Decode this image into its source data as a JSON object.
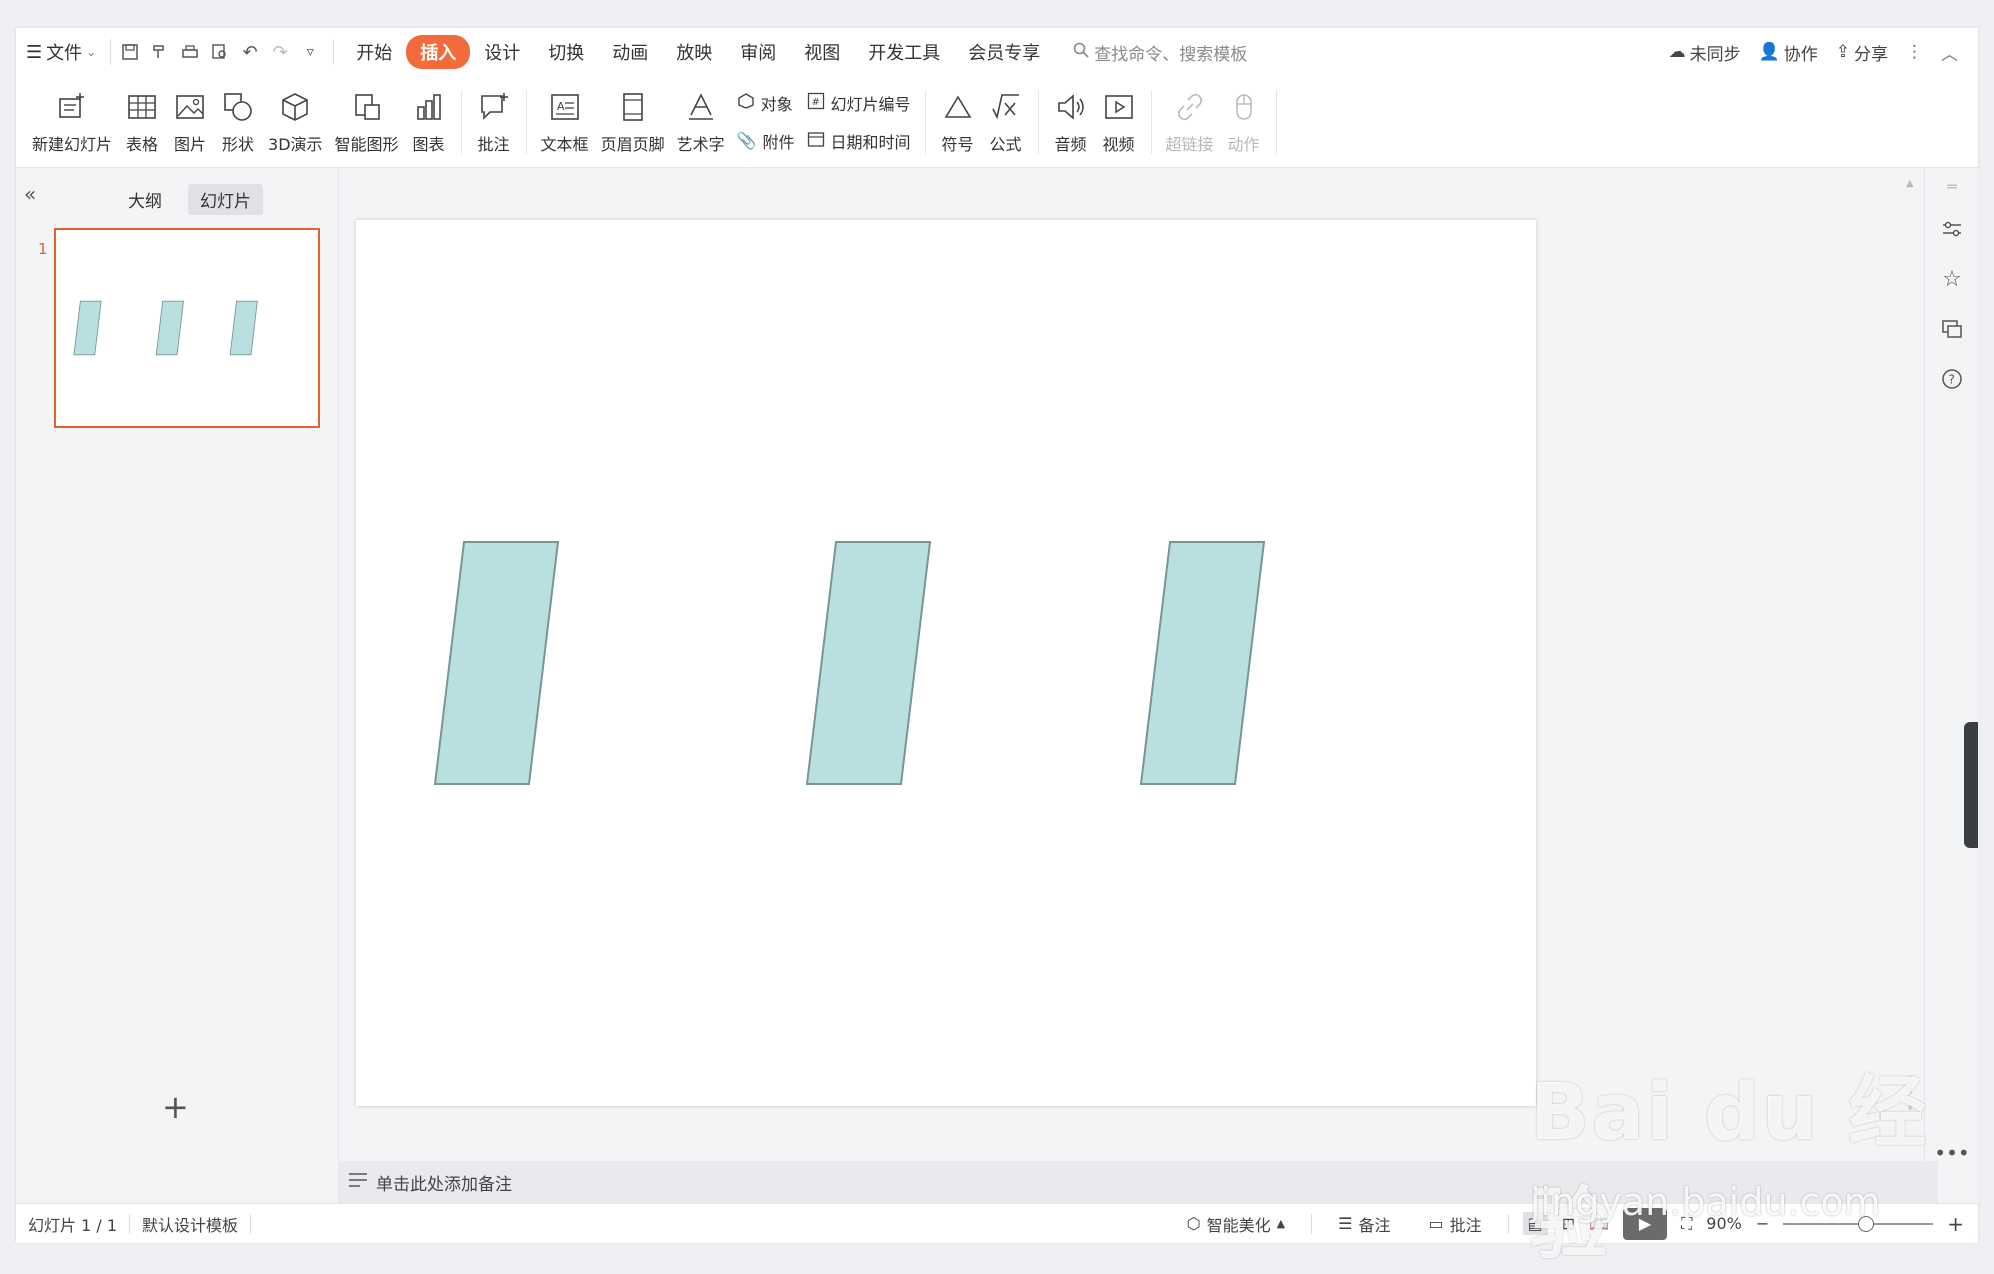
{
  "topbar": {
    "file_menu": "文件",
    "tabs": [
      "开始",
      "插入",
      "设计",
      "切换",
      "动画",
      "放映",
      "审阅",
      "视图",
      "开发工具",
      "会员专享"
    ],
    "active_tab": "插入",
    "search_placeholder": "查找命令、搜索模板",
    "sync": "未同步",
    "collab": "协作",
    "share": "分享"
  },
  "ribbon": {
    "new_slide": "新建幻灯片",
    "table": "表格",
    "picture": "图片",
    "shape": "形状",
    "demo3d": "3D演示",
    "smartart": "智能图形",
    "chart": "图表",
    "comment": "批注",
    "textbox": "文本框",
    "header_footer": "页眉页脚",
    "wordart": "艺术字",
    "object": "对象",
    "attachment": "附件",
    "slide_number": "幻灯片编号",
    "datetime": "日期和时间",
    "symbol": "符号",
    "formula": "公式",
    "audio": "音频",
    "video": "视频",
    "hyperlink": "超链接",
    "action": "动作"
  },
  "leftpanel": {
    "outline_tab": "大纲",
    "slides_tab": "幻灯片",
    "slide_number": "1"
  },
  "notes": {
    "placeholder": "单击此处添加备注"
  },
  "status": {
    "slide_info": "幻灯片 1 / 1",
    "template": "默认设计模板",
    "beautify": "智能美化",
    "notes": "备注",
    "comment": "批注",
    "zoom": "90%"
  },
  "watermark": {
    "brand": "Bai du 经验",
    "url": "jingyan.baidu.com"
  },
  "colors": {
    "accent": "#f26b3a",
    "shape_fill": "#b9dfe1",
    "shape_stroke": "#7a9596"
  }
}
